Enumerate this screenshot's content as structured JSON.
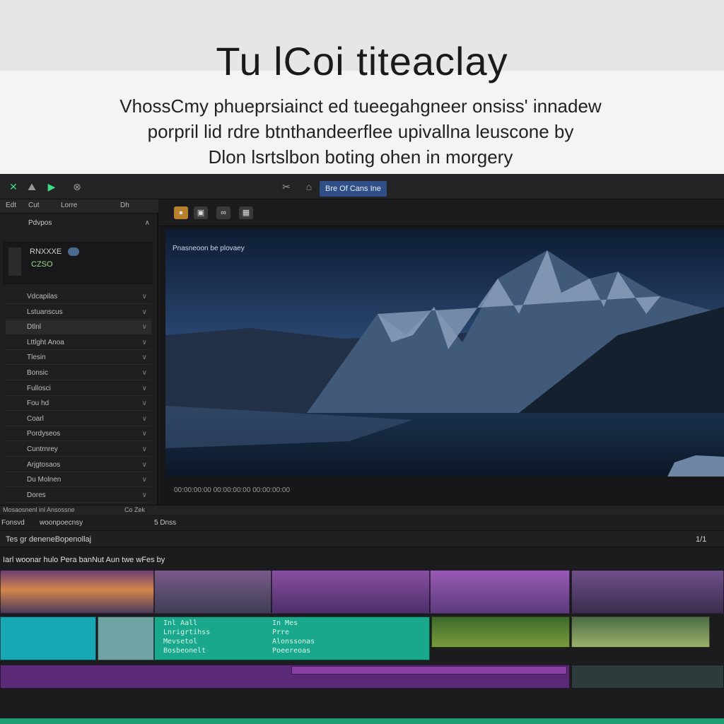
{
  "hero": {
    "title": "Tu lCoi titeaclay",
    "description_lines": [
      "VhossCmy phueprsiainct ed tueegahgneer onsiss' innadew",
      "porpril lid rdre btnthandeerflee upivallna leuscone by",
      "Dlon lsrtslbon boting ohen in morgery"
    ]
  },
  "topbar": {
    "project_label": "Bre Of Cans Ine",
    "icons": [
      "logo-x-icon",
      "mountain-icon",
      "play-icon",
      "globe-icon",
      "scissor-icon"
    ]
  },
  "left_panel": {
    "tabs": [
      "Edt",
      "Cut",
      "Lorre",
      "Dh"
    ],
    "header": {
      "big": "Pdvpos",
      "sub1": "RNXXXE",
      "sub2": "CZSO"
    },
    "rows": [
      {
        "num": "",
        "label": "Vdcapilas"
      },
      {
        "num": "",
        "label": "Lstuanscus"
      },
      {
        "num": "",
        "label": "Dtlnl"
      },
      {
        "num": "",
        "label": "Lttlght Anoa"
      },
      {
        "num": "",
        "label": "Tlesin"
      },
      {
        "num": "",
        "label": "Bonsic"
      },
      {
        "num": "",
        "label": "Fullosci"
      },
      {
        "num": "",
        "label": "Fou hd"
      },
      {
        "num": "",
        "label": "Coarl"
      },
      {
        "num": "",
        "label": "Pordyseos"
      },
      {
        "num": "",
        "label": "Cuntrnrey"
      },
      {
        "num": "",
        "label": "Arjgtosaos"
      },
      {
        "num": "",
        "label": "Du Molnen"
      },
      {
        "num": "",
        "label": "Dores"
      }
    ]
  },
  "viewer": {
    "caption": "Pnasneoon be plovaey",
    "timecode": "00:00:00:00 00:00:00:00 00:00:00:00",
    "toolbar_icons": [
      "brush-icon",
      "camera-icon",
      "link-icon",
      "film-icon"
    ]
  },
  "strip": {
    "left": "Mosaosnenl inl Ansossne",
    "right": "Co Zek"
  },
  "timeline": {
    "head_left": "Fonsvd",
    "head_mid": "woonpoecnsy",
    "head_right": "5 Dnss",
    "sub_left": "Tes gr deneneBopenollaj",
    "sub_right": "1/1",
    "track_title": "Iarl woonar hulo Pera banNut Aun twe wFes by",
    "clip_a_lines": [
      "Inl Aall",
      "Lnrigrtihss",
      "Mevsetol",
      "Bosbeonelt"
    ],
    "clip_b_lines": [
      "In Mes",
      "Prre",
      "Alonssonas",
      "Poeereoas"
    ]
  },
  "colors": {
    "accent_blue": "#2f4f86",
    "teal_clip": "#1aa88d",
    "purple_track": "#5a2a76",
    "green_bar": "#1d9d72"
  }
}
